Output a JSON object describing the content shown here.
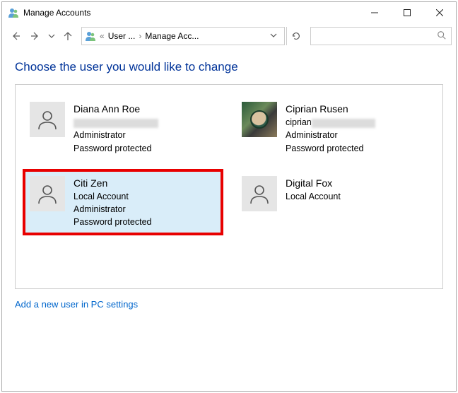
{
  "window": {
    "title": "Manage Accounts"
  },
  "breadcrumb": {
    "seg1": "User ...",
    "seg2": "Manage Acc..."
  },
  "heading": "Choose the user you would like to change",
  "accounts": [
    {
      "name": "Diana Ann Roe",
      "email": "",
      "role": "Administrator",
      "protection": "Password protected",
      "selected": false,
      "has_photo": false,
      "email_redacted": true
    },
    {
      "name": "Ciprian Rusen",
      "email_prefix": "ciprian",
      "role": "Administrator",
      "protection": "Password protected",
      "selected": false,
      "has_photo": true,
      "email_redacted": true
    },
    {
      "name": "Citi Zen",
      "account_type": "Local Account",
      "role": "Administrator",
      "protection": "Password protected",
      "selected": true,
      "has_photo": false
    },
    {
      "name": "Digital Fox",
      "account_type": "Local Account",
      "selected": false,
      "has_photo": false
    }
  ],
  "link": "Add a new user in PC settings"
}
